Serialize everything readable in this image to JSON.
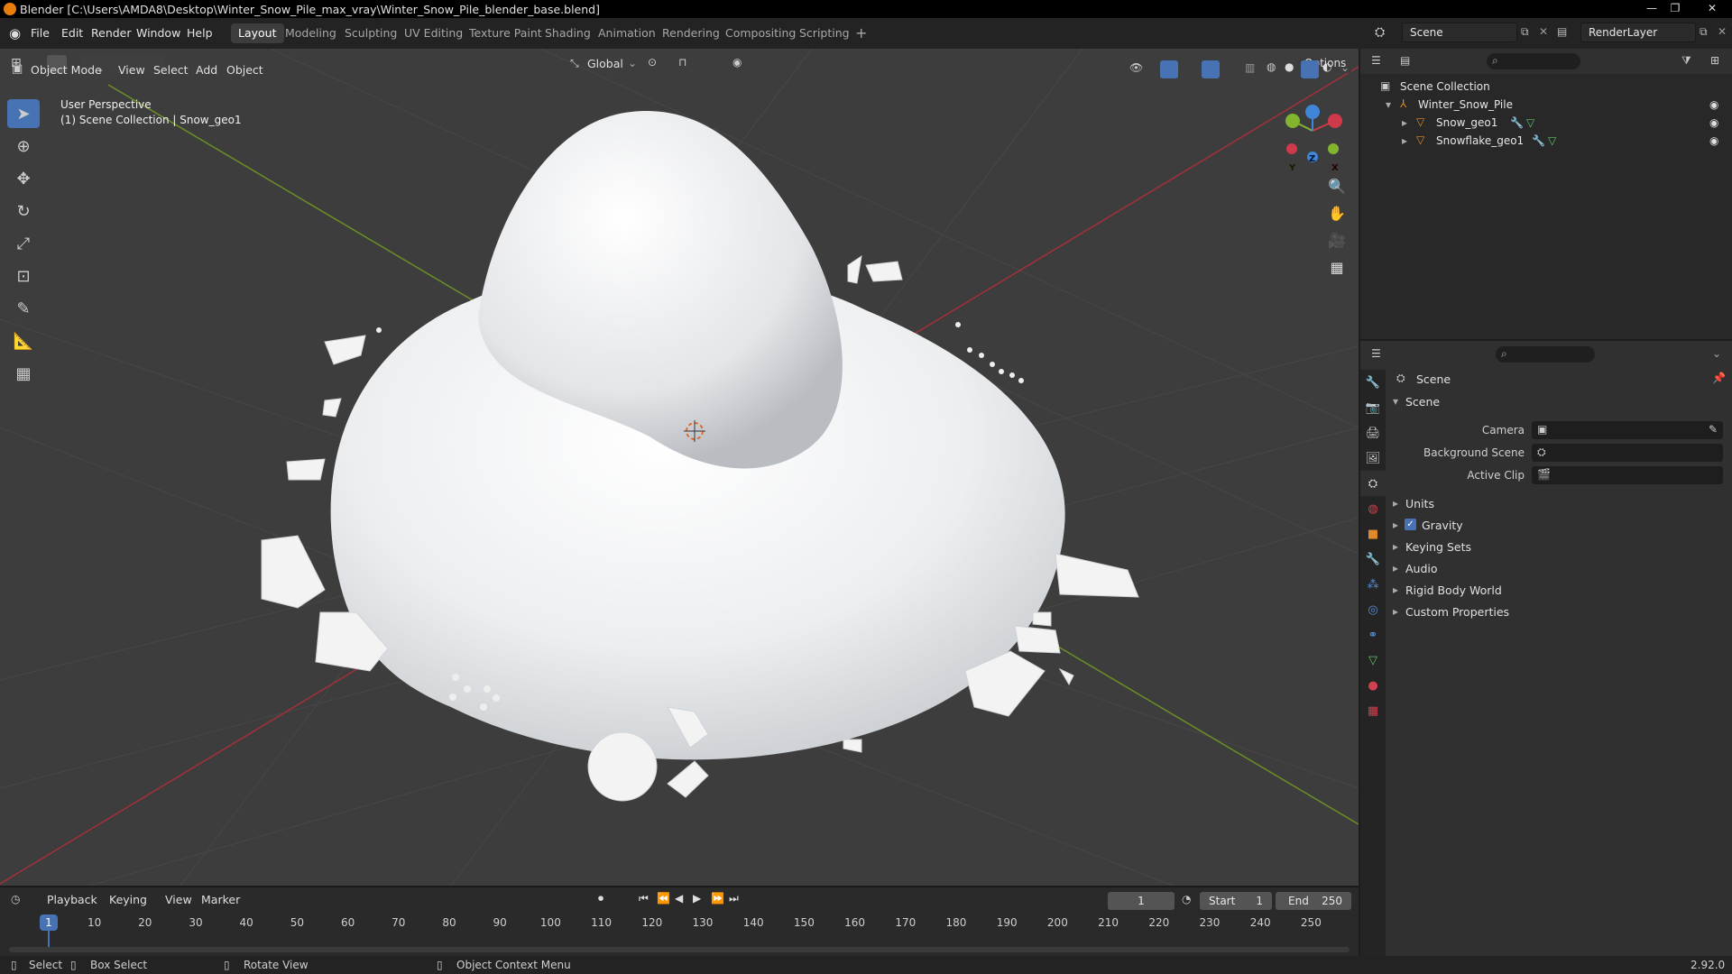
{
  "window": {
    "title": "Blender [C:\\Users\\AMDA8\\Desktop\\Winter_Snow_Pile_max_vray\\Winter_Snow_Pile_blender_base.blend]",
    "controls": [
      "—",
      "❐",
      "✕"
    ]
  },
  "menubar": {
    "menus": [
      "File",
      "Edit",
      "Render",
      "Window",
      "Help"
    ],
    "workspaces": [
      "Layout",
      "Modeling",
      "Sculpting",
      "UV Editing",
      "Texture Paint",
      "Shading",
      "Animation",
      "Rendering",
      "Compositing",
      "Scripting"
    ],
    "add_workspace": "+",
    "active_workspace": "Layout",
    "scene_name": "Scene",
    "render_layer": "RenderLayer"
  },
  "viewport": {
    "mode": "Object Mode",
    "menus": [
      "View",
      "Select",
      "Add",
      "Object"
    ],
    "transform_orientation": "Global",
    "options_label": "Options",
    "perspective_label": "User Perspective",
    "collection_label": "(1) Scene Collection | Snow_geo1",
    "gizmo_axes": [
      "X",
      "Y",
      "Z"
    ]
  },
  "outliner": {
    "root": "Scene Collection",
    "items": [
      {
        "name": "Winter_Snow_Pile"
      },
      {
        "name": "Snow_geo1"
      },
      {
        "name": "Snowflake_geo1"
      }
    ]
  },
  "properties": {
    "context_title": "Scene",
    "panel_title": "Scene",
    "fields": [
      {
        "label": "Camera"
      },
      {
        "label": "Background Scene"
      },
      {
        "label": "Active Clip"
      }
    ],
    "sections": [
      {
        "label": "Units",
        "checkbox": false
      },
      {
        "label": "Gravity",
        "checkbox": true
      },
      {
        "label": "Keying Sets",
        "checkbox": false
      },
      {
        "label": "Audio",
        "checkbox": false
      },
      {
        "label": "Rigid Body World",
        "checkbox": false
      },
      {
        "label": "Custom Properties",
        "checkbox": false
      }
    ]
  },
  "timeline": {
    "menus": [
      "Playback",
      "Keying",
      "View",
      "Marker"
    ],
    "current_frame": "1",
    "start_label": "Start",
    "start_value": "1",
    "end_label": "End",
    "end_value": "250",
    "ticks": [
      "1",
      "10",
      "20",
      "30",
      "40",
      "50",
      "60",
      "70",
      "80",
      "90",
      "100",
      "110",
      "120",
      "130",
      "140",
      "150",
      "160",
      "170",
      "180",
      "190",
      "200",
      "210",
      "220",
      "230",
      "240",
      "250"
    ]
  },
  "statusbar": {
    "select": "Select",
    "box_select": "Box Select",
    "rotate_view": "Rotate View",
    "context_menu": "Object Context Menu",
    "version": "2.92.0"
  },
  "colors": {
    "accent": "#4772b3",
    "x_axis": "#cf3a4a",
    "y_axis": "#83b42d",
    "z_axis": "#3f86d9",
    "snow": "#f2f2f2"
  }
}
